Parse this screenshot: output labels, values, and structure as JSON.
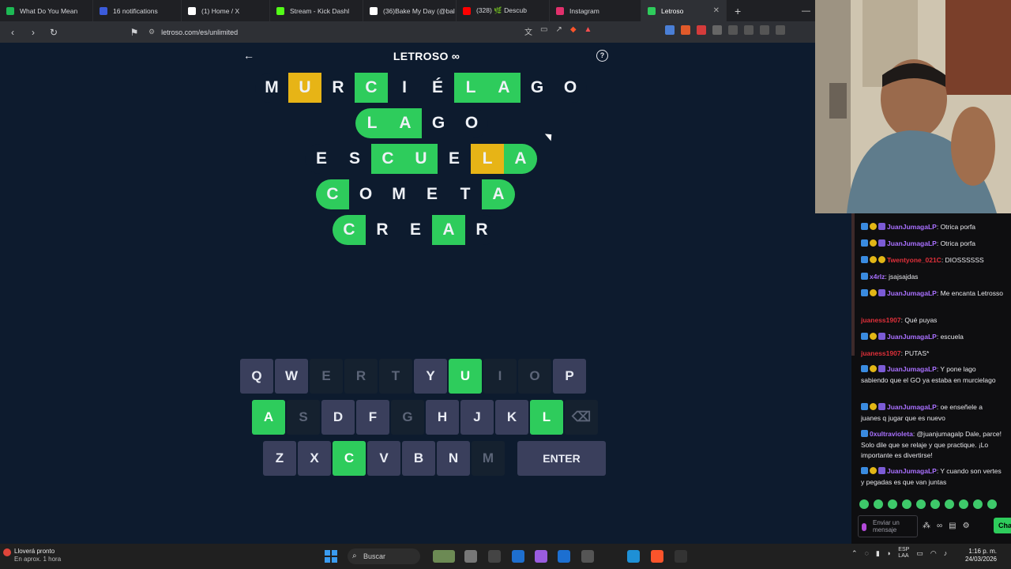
{
  "browser": {
    "tabs": [
      {
        "label": "What Do You Mean",
        "color": "#1db954"
      },
      {
        "label": "16 notifications",
        "color": "#3b5bdb"
      },
      {
        "label": "(1) Home / X",
        "color": "#ffffff"
      },
      {
        "label": "Stream - Kick Dashl",
        "color": "#53fc18"
      },
      {
        "label": "(36)Bake My Day (@bal",
        "color": "#ffffff"
      },
      {
        "label": "(328) 🌿 Descub",
        "color": "#ff0000"
      },
      {
        "label": "Instagram",
        "color": "#e1306c"
      },
      {
        "label": "Letroso",
        "color": "#2ecc5c",
        "active": true
      }
    ],
    "url": "letroso.com/es/unlimited"
  },
  "game": {
    "logo": "LETROSO ∞",
    "rows": [
      [
        {
          "l": "M",
          "s": "plain"
        },
        {
          "l": "U",
          "s": "yellow"
        },
        {
          "l": "R",
          "s": "plain"
        },
        {
          "l": "C",
          "s": "green"
        },
        {
          "l": "I",
          "s": "plain"
        },
        {
          "l": "É",
          "s": "plain"
        },
        {
          "l": "L",
          "s": "green"
        },
        {
          "l": "A",
          "s": "green"
        },
        {
          "l": "G",
          "s": "plain"
        },
        {
          "l": "O",
          "s": "plain"
        }
      ],
      [
        {
          "l": "L",
          "s": "green"
        },
        {
          "l": "A",
          "s": "green"
        },
        {
          "l": "G",
          "s": "plain"
        },
        {
          "l": "O",
          "s": "plain"
        }
      ],
      [
        {
          "l": "E",
          "s": "plain"
        },
        {
          "l": "S",
          "s": "plain"
        },
        {
          "l": "C",
          "s": "green"
        },
        {
          "l": "U",
          "s": "green"
        },
        {
          "l": "E",
          "s": "plain"
        },
        {
          "l": "L",
          "s": "yellow"
        },
        {
          "l": "A",
          "s": "green"
        }
      ],
      [
        {
          "l": "C",
          "s": "green"
        },
        {
          "l": "O",
          "s": "plain"
        },
        {
          "l": "M",
          "s": "plain"
        },
        {
          "l": "E",
          "s": "plain"
        },
        {
          "l": "T",
          "s": "plain"
        },
        {
          "l": "A",
          "s": "green"
        }
      ],
      [
        {
          "l": "C",
          "s": "green"
        },
        {
          "l": "R",
          "s": "plain"
        },
        {
          "l": "E",
          "s": "plain"
        },
        {
          "l": "A",
          "s": "green"
        },
        {
          "l": "R",
          "s": "plain"
        }
      ]
    ],
    "keyboard": [
      [
        {
          "k": "Q",
          "s": ""
        },
        {
          "k": "W",
          "s": ""
        },
        {
          "k": "E",
          "s": "used"
        },
        {
          "k": "R",
          "s": "used"
        },
        {
          "k": "T",
          "s": "used"
        },
        {
          "k": "Y",
          "s": ""
        },
        {
          "k": "U",
          "s": "green"
        },
        {
          "k": "I",
          "s": "used"
        },
        {
          "k": "O",
          "s": "used"
        },
        {
          "k": "P",
          "s": ""
        }
      ],
      [
        {
          "k": "A",
          "s": "green"
        },
        {
          "k": "S",
          "s": "used"
        },
        {
          "k": "D",
          "s": ""
        },
        {
          "k": "F",
          "s": ""
        },
        {
          "k": "G",
          "s": "used"
        },
        {
          "k": "H",
          "s": ""
        },
        {
          "k": "J",
          "s": ""
        },
        {
          "k": "K",
          "s": ""
        },
        {
          "k": "L",
          "s": "green"
        },
        {
          "k": "⌫",
          "s": "used"
        }
      ],
      [
        {
          "k": "Z",
          "s": ""
        },
        {
          "k": "X",
          "s": ""
        },
        {
          "k": "C",
          "s": "green"
        },
        {
          "k": "V",
          "s": ""
        },
        {
          "k": "B",
          "s": ""
        },
        {
          "k": "N",
          "s": ""
        },
        {
          "k": "M",
          "s": "used"
        }
      ]
    ],
    "enter_label": "ENTER"
  },
  "chat": {
    "messages": [
      {
        "user": "JuanJumagaLP",
        "color": "#a970ff",
        "text": "Otrica porfa",
        "badges": [
          "b-blue",
          "b-gold",
          "b-purple"
        ]
      },
      {
        "user": "JuanJumagaLP",
        "color": "#a970ff",
        "text": "Otrica porfa",
        "badges": [
          "b-blue",
          "b-gold",
          "b-purple"
        ]
      },
      {
        "user": "Twentyone_021C",
        "color": "#e0303a",
        "text": "DIOSSSSSS",
        "badges": [
          "b-blue",
          "b-gold",
          "b-gold"
        ]
      },
      {
        "user": "x4rlz",
        "color": "#a970ff",
        "text": "jsajsajdas",
        "badges": [
          "b-blue"
        ]
      },
      {
        "user": "JuanJumagaLP",
        "color": "#a970ff",
        "text": "Me encanta Letrosso",
        "badges": [
          "b-blue",
          "b-gold",
          "b-purple"
        ]
      },
      {
        "user": "juaness1907",
        "color": "#e0303a",
        "text": "Qué puyas",
        "badges": []
      },
      {
        "user": "JuanJumagaLP",
        "color": "#a970ff",
        "text": "escuela",
        "badges": [
          "b-blue",
          "b-gold",
          "b-purple"
        ]
      },
      {
        "user": "juaness1907",
        "color": "#e0303a",
        "text": "PUTAS*",
        "badges": []
      },
      {
        "user": "JuanJumagaLP",
        "color": "#a970ff",
        "text": "Y pone lago sabiendo que el GO ya estaba en murcielago",
        "badges": [
          "b-blue",
          "b-gold",
          "b-purple"
        ]
      },
      {
        "user": "JuanJumagaLP",
        "color": "#a970ff",
        "text": "oe enseñele a juanes q jugar que es nuevo",
        "badges": [
          "b-blue",
          "b-gold",
          "b-purple"
        ]
      },
      {
        "user": "0xultravioleta",
        "color": "#a970ff",
        "text": "@juanjumagalp Dale, parce! Solo dile que se relaje y que practique. ¡Lo importante es divertirse!",
        "badges": [
          "b-blue"
        ]
      },
      {
        "user": "JuanJumagaLP",
        "color": "#a970ff",
        "text": "Y cuando son vertes y pegadas es que van juntas",
        "badges": [
          "b-blue",
          "b-gold",
          "b-purple"
        ]
      }
    ],
    "input_placeholder": "Enviar un mensaje",
    "send_label": "Chat"
  },
  "taskbar": {
    "weather_line1": "Lloverá pronto",
    "weather_line2": "En aprox. 1 hora",
    "search_placeholder": "Buscar",
    "lang_line1": "ESP",
    "lang_line2": "LAA",
    "time": "1:16 p. m.",
    "date": "24/03/2026"
  }
}
